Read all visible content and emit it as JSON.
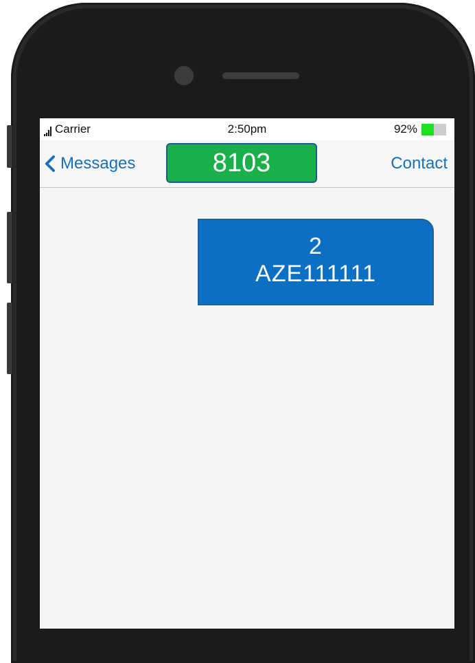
{
  "status_bar": {
    "carrier": "Carrier",
    "time": "2:50pm",
    "battery_percent": "92%",
    "battery_level": 0.5,
    "battery_color": "#1fe01f"
  },
  "nav": {
    "back_label": "Messages",
    "title": "8103",
    "title_bg": "#1ab04b",
    "contact_label": "Contact",
    "accent": "#1a6fb8"
  },
  "messages": [
    {
      "direction": "outgoing",
      "lines": [
        "2",
        "AZE111111"
      ],
      "bg": "#0b6fc2"
    }
  ]
}
